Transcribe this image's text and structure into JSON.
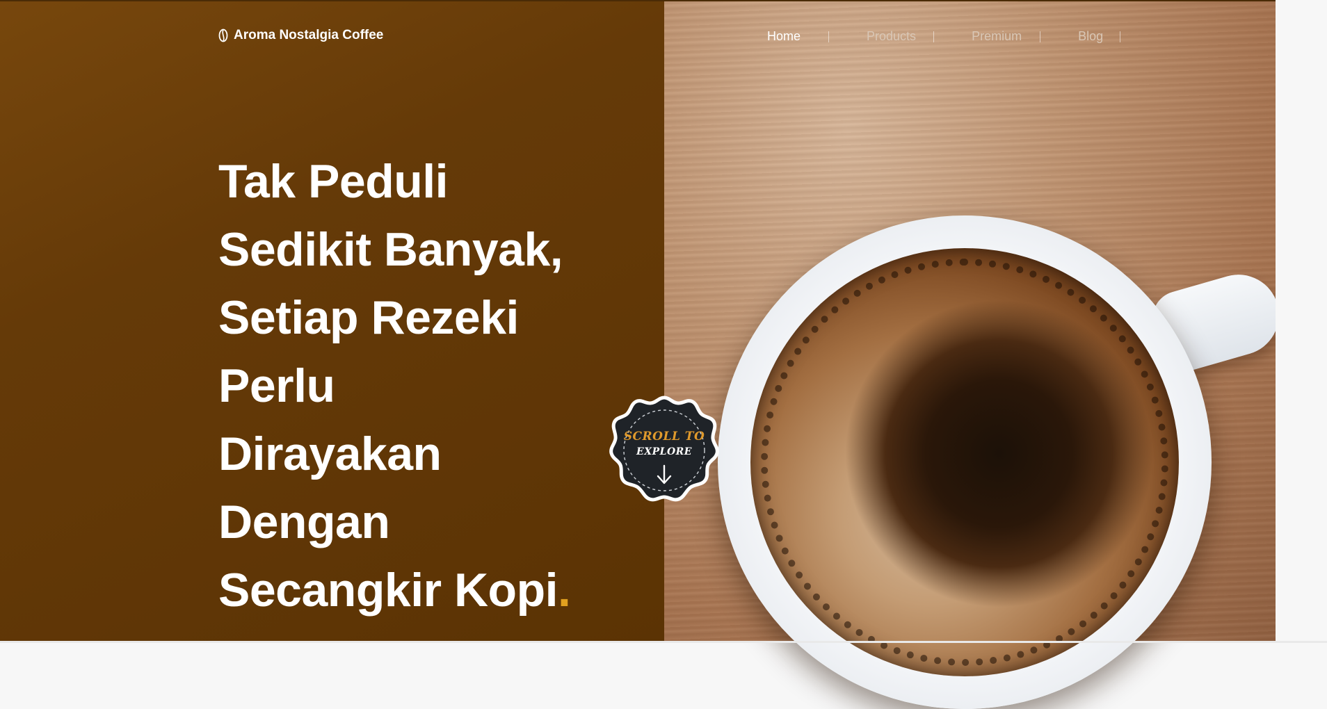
{
  "brand": {
    "name": "Aroma Nostalgia Coffee",
    "icon": "coffee-bean-icon"
  },
  "nav": {
    "items": [
      {
        "label": "Home",
        "active": true
      },
      {
        "label": "Products",
        "active": false
      },
      {
        "label": "Premium",
        "active": false
      },
      {
        "label": "Blog",
        "active": false
      }
    ]
  },
  "hero": {
    "lines": [
      "Tak Peduli",
      "Sedikit Banyak,",
      "Setiap Rezeki",
      "Perlu",
      "Dirayakan",
      "Dengan",
      "Secangkir Kopi"
    ],
    "end_mark": ".",
    "accent_color": "#e2a11f",
    "panel_color": "#653a08"
  },
  "scroll_badge": {
    "line1": "SCROLL TO",
    "line2": "EXPLORE",
    "icon": "arrow-down-icon"
  }
}
